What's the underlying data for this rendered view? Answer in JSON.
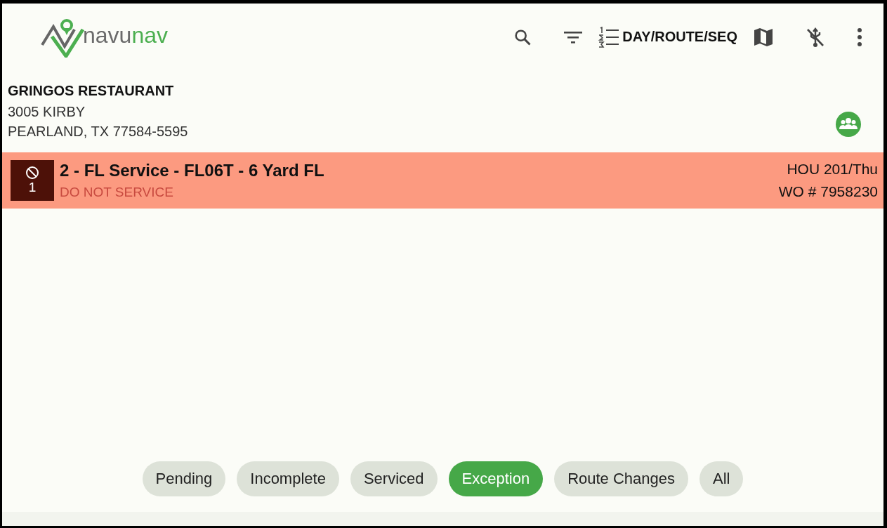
{
  "logo": {
    "text_grey": "navu",
    "text_green": "nav"
  },
  "toolbar": {
    "sort_label": "DAY/ROUTE/SEQ"
  },
  "customer": {
    "name": "GRINGOS RESTAURANT",
    "address_line_1": "3005 KIRBY",
    "address_line_2": "PEARLAND, TX 77584-5595"
  },
  "orders": [
    {
      "blocked": true,
      "count": "1",
      "title": "2 - FL Service - FL06T - 6 Yard FL",
      "note": "DO NOT SERVICE",
      "route": "HOU 201/Thu",
      "work_order": "WO # 7958230"
    }
  ],
  "filters": [
    {
      "label": "Pending",
      "selected": false
    },
    {
      "label": "Incomplete",
      "selected": false
    },
    {
      "label": "Serviced",
      "selected": false
    },
    {
      "label": "Exception",
      "selected": true
    },
    {
      "label": "Route Changes",
      "selected": false
    },
    {
      "label": "All",
      "selected": false
    }
  ]
}
